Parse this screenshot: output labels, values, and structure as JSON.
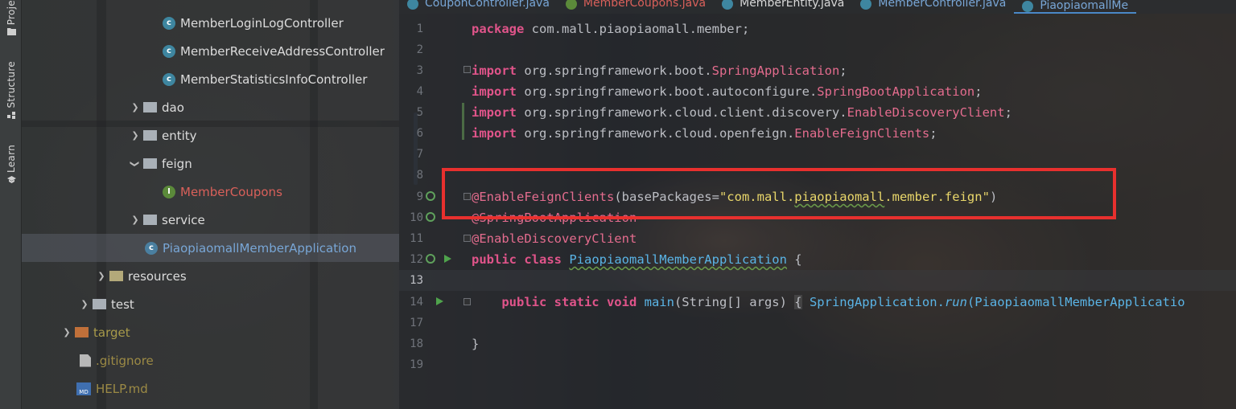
{
  "tool_strip": {
    "items": [
      {
        "label": "Proje"
      },
      {
        "label": "Structure"
      },
      {
        "label": "Learn"
      }
    ]
  },
  "project_tree": {
    "header_label": "Project",
    "rows": [
      {
        "label": "MemberLoginLogController",
        "kind": "class"
      },
      {
        "label": "MemberReceiveAddressController",
        "kind": "class"
      },
      {
        "label": "MemberStatisticsInfoController",
        "kind": "class"
      },
      {
        "label": "dao",
        "kind": "folder",
        "expanded": false
      },
      {
        "label": "entity",
        "kind": "folder",
        "expanded": false
      },
      {
        "label": "feign",
        "kind": "folder",
        "expanded": true
      },
      {
        "label": "MemberCoupons",
        "kind": "interface"
      },
      {
        "label": "service",
        "kind": "folder",
        "expanded": false
      },
      {
        "label": "PiaopiaomallMemberApplication",
        "kind": "springboot-class",
        "selected": true
      },
      {
        "label": "resources",
        "kind": "resources-folder",
        "expanded": false
      },
      {
        "label": "test",
        "kind": "folder",
        "expanded": false
      },
      {
        "label": "target",
        "kind": "excluded-folder",
        "expanded": false
      },
      {
        "label": ".gitignore",
        "kind": "file"
      },
      {
        "label": "HELP.md",
        "kind": "markdown"
      }
    ]
  },
  "editor_tabs": [
    {
      "label": "CouponController.java",
      "color": "#78a6d6"
    },
    {
      "label": "MemberCoupons.java",
      "color": "#d9605a"
    },
    {
      "label": "MemberEntity.java",
      "color": "#d8d8d8"
    },
    {
      "label": "MemberController.java",
      "color": "#78a6d6"
    },
    {
      "label": "PiaopiaomallMe",
      "color": "#78a6d6",
      "active": true
    }
  ],
  "code": {
    "line_numbers": [
      "1",
      "2",
      "3",
      "4",
      "5",
      "6",
      "7",
      "8",
      "9",
      "10",
      "11",
      "12",
      "13",
      "14",
      "17",
      "18",
      "19"
    ],
    "current_line": "13",
    "lines": {
      "l1": {
        "kw": "package",
        "rest": " com.mall.piaopiaomall.member;"
      },
      "l3": {
        "kw": "import",
        "pkg": " org.springframework.boot.",
        "cls": "SpringApplication",
        "end": ";"
      },
      "l4": {
        "kw": "import",
        "pkg": " org.springframework.boot.autoconfigure.",
        "cls": "SpringBootApplication",
        "end": ";"
      },
      "l5": {
        "kw": "import",
        "pkg": " org.springframework.cloud.client.discovery.",
        "cls": "EnableDiscoveryClient",
        "end": ";"
      },
      "l6": {
        "kw": "import",
        "pkg": " org.springframework.cloud.openfeign.",
        "cls": "EnableFeignClients",
        "end": ";"
      },
      "l9": {
        "ann": "@EnableFeignClients",
        "open": "(basePackages=",
        "str_a": "\"com.mall.",
        "str_b": "piaopiaomall",
        "str_c": ".member.feign\"",
        "close": ")"
      },
      "l10": {
        "ann": "@SpringBootApplication"
      },
      "l11": {
        "ann": "@EnableDiscoveryClient"
      },
      "l12": {
        "kw": "public class ",
        "cls": "PiaopiaomallMemberApplication",
        "end": " {"
      },
      "l14": {
        "kw": "public static void ",
        "method": "main",
        "args_a": "(String[] args) ",
        "brace": "{",
        "call_a": " SpringApplication.",
        "call_b": "run",
        "call_c": "(PiaopiaomallMemberApplicatio"
      },
      "l18": {
        "brace": "}"
      }
    }
  },
  "colors": {
    "keyword": "#e0548a",
    "string": "#e9d76a",
    "annotation_box": "#e8302e",
    "selection": "#5f646e"
  }
}
